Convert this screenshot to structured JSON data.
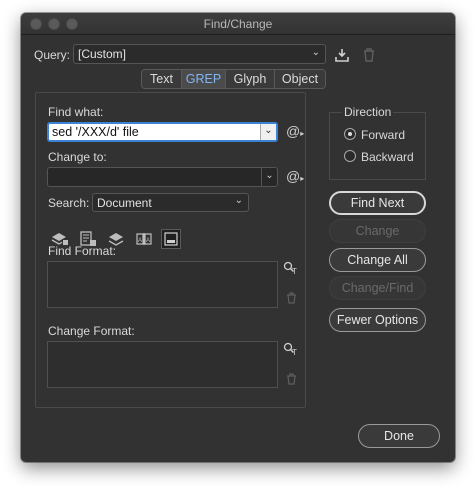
{
  "window": {
    "title": "Find/Change"
  },
  "query": {
    "label": "Query:",
    "value": "[Custom]"
  },
  "tabs": [
    {
      "label": "Text",
      "active": false
    },
    {
      "label": "GREP",
      "active": true
    },
    {
      "label": "Glyph",
      "active": false
    },
    {
      "label": "Object",
      "active": false
    }
  ],
  "find_what": {
    "label": "Find what:",
    "value": "sed '/XXX/d' file"
  },
  "change_to": {
    "label": "Change to:",
    "value": ""
  },
  "search": {
    "label": "Search:",
    "value": "Document"
  },
  "find_format": {
    "label": "Find Format:"
  },
  "change_format": {
    "label": "Change Format:"
  },
  "direction": {
    "title": "Direction",
    "options": [
      {
        "label": "Forward",
        "selected": true
      },
      {
        "label": "Backward",
        "selected": false
      }
    ]
  },
  "buttons": {
    "find_next": "Find Next",
    "change": "Change",
    "change_all": "Change All",
    "change_find": "Change/Find",
    "fewer_options": "Fewer Options",
    "done": "Done"
  },
  "special_char_symbol": "@",
  "colors": {
    "accent": "#7fb6f3",
    "focus": "#3b84d4",
    "background": "#323232"
  }
}
